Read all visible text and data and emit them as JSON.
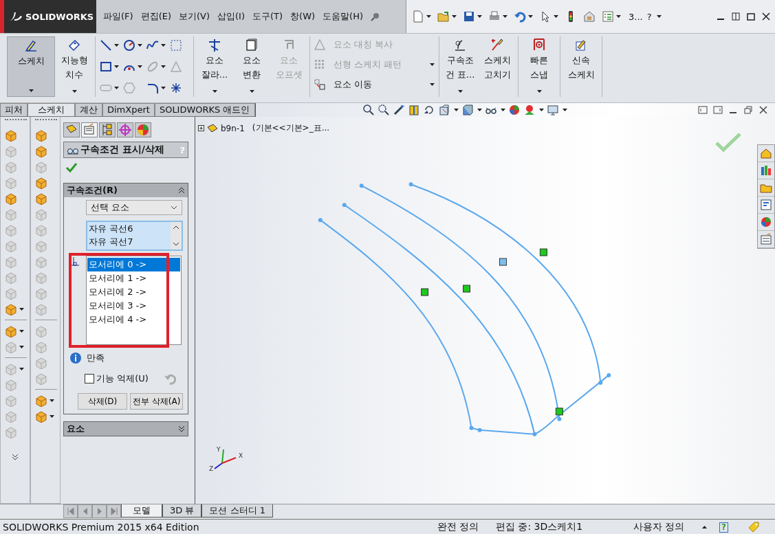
{
  "app": {
    "logo": "SOLIDWORKS"
  },
  "menus": [
    "파일(F)",
    "편집(E)",
    "보기(V)",
    "삽입(I)",
    "도구(T)",
    "창(W)",
    "도움말(H)"
  ],
  "quick_access": {
    "overflow": "3...",
    "help": "?"
  },
  "ribbon": {
    "groups": [
      {
        "kind": "large",
        "buttons": [
          {
            "lines": [
              "스케치"
            ],
            "selected": true,
            "dropdown": true,
            "disabled": false
          },
          {
            "lines": [
              "지능형",
              "치수"
            ],
            "selected": false,
            "dropdown": true,
            "disabled": false
          }
        ]
      },
      {
        "kind": "tools",
        "tools": [
          {
            "disabled": false,
            "dropdown": true
          },
          {
            "disabled": false,
            "dropdown": true
          },
          {
            "disabled": false,
            "dropdown": true
          },
          {
            "disabled": false,
            "dropdown": false
          },
          {
            "disabled": false,
            "dropdown": true
          },
          {
            "disabled": false,
            "dropdown": true
          },
          {
            "disabled": true,
            "dropdown": true
          },
          {
            "disabled": true,
            "dropdown": false
          },
          {
            "disabled": true,
            "dropdown": true
          },
          {
            "disabled": true,
            "dropdown": false
          },
          {
            "disabled": false,
            "dropdown": true
          },
          {
            "disabled": false,
            "dropdown": false
          }
        ]
      },
      {
        "kind": "large",
        "buttons": [
          {
            "lines": [
              "요소",
              "잘라..."
            ],
            "selected": false,
            "dropdown": true,
            "disabled": false
          },
          {
            "lines": [
              "요소",
              "변환"
            ],
            "selected": false,
            "dropdown": true,
            "disabled": false
          },
          {
            "lines": [
              "요소",
              "오프셋"
            ],
            "selected": false,
            "dropdown": false,
            "disabled": true
          }
        ]
      },
      {
        "kind": "small",
        "buttons": [
          {
            "label": "요소 대칭 복사",
            "disabled": true,
            "dropdown": false
          },
          {
            "label": "선형 스케치 패턴",
            "disabled": true,
            "dropdown": true
          },
          {
            "label": "요소 이동",
            "disabled": false,
            "dropdown": true
          }
        ]
      },
      {
        "kind": "large",
        "buttons": [
          {
            "lines": [
              "구속조",
              "건 표..."
            ],
            "selected": false,
            "dropdown": true,
            "disabled": false
          },
          {
            "lines": [
              "스케치",
              "고치기"
            ],
            "selected": false,
            "dropdown": false,
            "disabled": false
          }
        ]
      },
      {
        "kind": "large",
        "buttons": [
          {
            "lines": [
              "빠른",
              "스냅"
            ],
            "selected": false,
            "dropdown": true,
            "disabled": false
          }
        ]
      },
      {
        "kind": "large",
        "buttons": [
          {
            "lines": [
              "신속",
              "스케치"
            ],
            "selected": false,
            "dropdown": false,
            "disabled": false
          }
        ]
      }
    ]
  },
  "command_tabs": [
    {
      "label": "피처",
      "selected": false
    },
    {
      "label": "스케치",
      "selected": true
    },
    {
      "label": "계산",
      "selected": false
    },
    {
      "label": "DimXpert",
      "selected": false
    },
    {
      "label": "SOLIDWORKS 애드인",
      "selected": false
    }
  ],
  "left_toolbars": {
    "column_1": [
      [
        {
          "disabled": false,
          "dropdown": false
        },
        {
          "disabled": true,
          "dropdown": false
        },
        {
          "disabled": true,
          "dropdown": false
        },
        {
          "disabled": true,
          "dropdown": false
        },
        {
          "disabled": false,
          "dropdown": false
        },
        {
          "disabled": true,
          "dropdown": false
        },
        {
          "disabled": true,
          "dropdown": false
        },
        {
          "disabled": true,
          "dropdown": false
        },
        {
          "disabled": true,
          "dropdown": false
        },
        {
          "disabled": true,
          "dropdown": false
        },
        {
          "disabled": true,
          "dropdown": false
        },
        {
          "disabled": false,
          "dropdown": true
        }
      ],
      [
        {
          "disabled": false,
          "dropdown": true
        },
        {
          "disabled": true,
          "dropdown": true
        }
      ],
      [
        {
          "disabled": true,
          "dropdown": true
        },
        {
          "disabled": true,
          "dropdown": false
        },
        {
          "disabled": true,
          "dropdown": false
        },
        {
          "disabled": true,
          "dropdown": false
        },
        {
          "disabled": true,
          "dropdown": false
        }
      ]
    ],
    "column_2": [
      [
        {
          "disabled": false,
          "dropdown": false
        },
        {
          "disabled": false,
          "dropdown": false
        },
        {
          "disabled": true,
          "dropdown": false
        },
        {
          "disabled": false,
          "dropdown": false
        },
        {
          "disabled": false,
          "dropdown": false
        },
        {
          "disabled": true,
          "dropdown": false
        },
        {
          "disabled": true,
          "dropdown": false
        },
        {
          "disabled": true,
          "dropdown": false
        },
        {
          "disabled": true,
          "dropdown": false
        },
        {
          "disabled": true,
          "dropdown": false
        },
        {
          "disabled": true,
          "dropdown": false
        },
        {
          "disabled": true,
          "dropdown": false
        }
      ],
      [
        {
          "disabled": true,
          "dropdown": false
        },
        {
          "disabled": true,
          "dropdown": false
        },
        {
          "disabled": true,
          "dropdown": false
        },
        {
          "disabled": true,
          "dropdown": false
        }
      ],
      [
        {
          "disabled": false,
          "dropdown": true
        },
        {
          "disabled": false,
          "dropdown": true
        }
      ]
    ]
  },
  "property_manager": {
    "tabs": [
      {
        "selected": false
      },
      {
        "selected": true
      },
      {
        "selected": false
      },
      {
        "selected": false
      },
      {
        "selected": false
      }
    ],
    "title": "구속조건 표시/삭제",
    "help": "?",
    "relations_section": {
      "title": "구속조건(R)",
      "expanded": true,
      "filter": "선택 요소",
      "selected_entities": [
        "자유 곡선6",
        "자유 곡선7"
      ],
      "relations": [
        {
          "label": "모서리에 0 ->",
          "selected": true
        },
        {
          "label": "모서리에 1 ->",
          "selected": false
        },
        {
          "label": "모서리에 2 ->",
          "selected": false
        },
        {
          "label": "모서리에 3 ->",
          "selected": false
        },
        {
          "label": "모서리에 4 ->",
          "selected": false
        }
      ],
      "status": "만족",
      "suppress": {
        "label": "기능 억제(U)",
        "checked": false
      },
      "buttons": [
        "삭제(D)",
        "전부 삭제(A)"
      ]
    },
    "entities_section": {
      "title": "요소",
      "expanded": false
    }
  },
  "viewport": {
    "tree": {
      "name": "b9n-1",
      "config": "(기본<<기본>_표..."
    },
    "triad": {
      "x": "X",
      "y": "Y",
      "z": "Z"
    }
  },
  "bottom_tabs": [
    {
      "label": "모델",
      "selected": true
    },
    {
      "label": "3D 뷰",
      "selected": false
    },
    {
      "label": "모션 스터디 1",
      "selected": false
    }
  ],
  "status_bar": {
    "product": "SOLIDWORKS Premium 2015 x64 Edition",
    "definition": "완전 정의",
    "editing": "편집 중: 3D스케치1",
    "units": "사용자 정의",
    "help": "?"
  }
}
